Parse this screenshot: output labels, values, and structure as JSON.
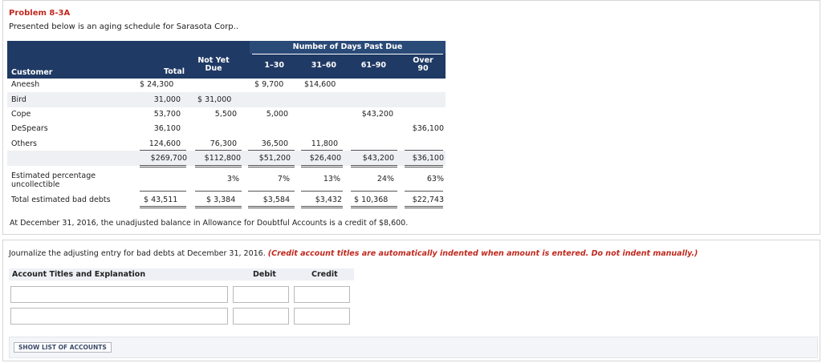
{
  "problem": {
    "title": "Problem 8-3A",
    "subtitle": "Presented below is an aging schedule for Sarasota Corp.."
  },
  "aging_table": {
    "group_header": "Number of Days Past Due",
    "headers": {
      "customer": "Customer",
      "total": "Total",
      "not_yet_due_1": "Not Yet",
      "not_yet_due_2": "Due",
      "d1_30": "1–30",
      "d31_60": "31–60",
      "d61_90": "61–90",
      "over_1": "Over",
      "over_2": "90"
    },
    "rows": [
      {
        "name": "Aneesh",
        "total": "$ 24,300",
        "not_yet_due": "",
        "d1_30": "$ 9,700",
        "d31_60": "$14,600",
        "d61_90": "",
        "over90": ""
      },
      {
        "name": "Bird",
        "total": "31,000",
        "not_yet_due": "$ 31,000",
        "d1_30": "",
        "d31_60": "",
        "d61_90": "",
        "over90": ""
      },
      {
        "name": "Cope",
        "total": "53,700",
        "not_yet_due": "5,500",
        "d1_30": "5,000",
        "d31_60": "",
        "d61_90": "$43,200",
        "over90": ""
      },
      {
        "name": "DeSpears",
        "total": "36,100",
        "not_yet_due": "",
        "d1_30": "",
        "d31_60": "",
        "d61_90": "",
        "over90": "$36,100"
      },
      {
        "name": "Others",
        "total": "124,600",
        "not_yet_due": "76,300",
        "d1_30": "36,500",
        "d31_60": "11,800",
        "d61_90": "",
        "over90": ""
      }
    ],
    "totals": {
      "total": "$269,700",
      "not_yet_due": "$112,800",
      "d1_30": "$51,200",
      "d31_60": "$26,400",
      "d61_90": "$43,200",
      "over90": "$36,100"
    },
    "pct_label_1": "Estimated percentage",
    "pct_label_2": "uncollectible",
    "pct": {
      "not_yet_due": "3%",
      "d1_30": "7%",
      "d31_60": "13%",
      "d61_90": "24%",
      "over90": "63%"
    },
    "bad_debts_label": "Total estimated bad debts",
    "bad_debts": {
      "total": "$ 43,511",
      "not_yet_due": "$ 3,384",
      "d1_30": "$3,584",
      "d31_60": "$3,432",
      "d61_90": "$ 10,368",
      "over90": "$22,743"
    }
  },
  "note": "At December 31, 2016, the unadjusted balance in Allowance for Doubtful Accounts is a credit of $8,600.",
  "journal": {
    "instruction": "Journalize the adjusting entry for bad debts at December 31, 2016.",
    "instruction_red": "(Credit account titles are automatically indented when amount is entered. Do not indent manually.)",
    "col_account": "Account Titles and Explanation",
    "col_debit": "Debit",
    "col_credit": "Credit",
    "rows": [
      {
        "account": "",
        "debit": "",
        "credit": ""
      },
      {
        "account": "",
        "debit": "",
        "credit": ""
      }
    ],
    "show_list_button": "SHOW LIST OF ACCOUNTS"
  }
}
